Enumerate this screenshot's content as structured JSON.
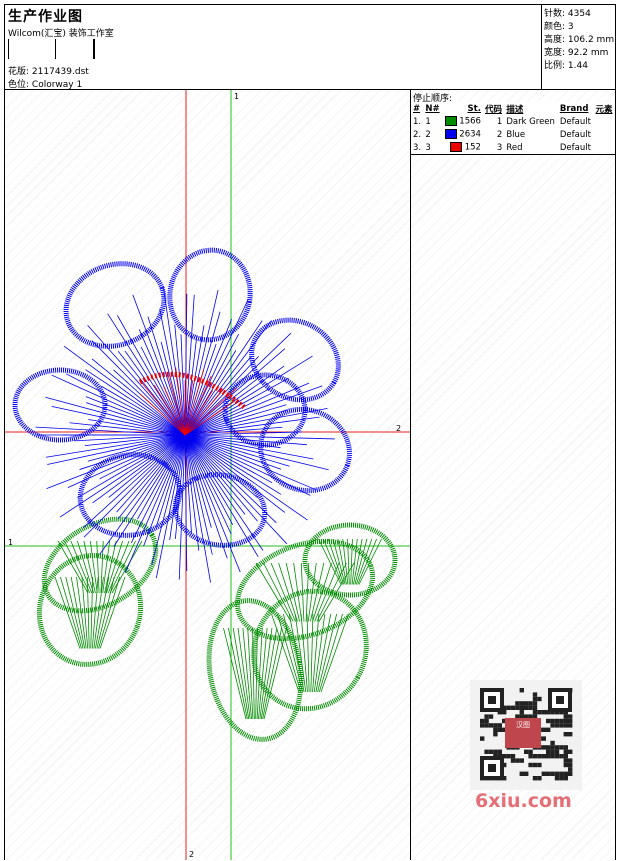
{
  "header": {
    "title": "生产作业图",
    "company": "Wilcom(汇宝) 装饰工作室",
    "design_label": "花版:",
    "design_value": "2117439.dst",
    "colorway_label": "色位:",
    "colorway_value": "Colorway 1"
  },
  "stats": [
    {
      "label": "针数:",
      "value": "4354"
    },
    {
      "label": "颜色:",
      "value": "3"
    },
    {
      "label": "高度:",
      "value": "106.2 mm"
    },
    {
      "label": "宽度:",
      "value": "92.2 mm"
    },
    {
      "label": "比例:",
      "value": "1.44"
    }
  ],
  "stop_sequence": {
    "title": "停止顺序:",
    "columns": [
      "#",
      "N#",
      "St.",
      "代码",
      "描述",
      "Brand",
      "元素"
    ],
    "rows": [
      {
        "index": "1.",
        "n": "1",
        "color": "#008c00",
        "stitches": "1566",
        "code": "1",
        "description": "Dark Green",
        "brand": "Default"
      },
      {
        "index": "2.",
        "n": "2",
        "color": "#0000ee",
        "stitches": "2634",
        "code": "2",
        "description": "Blue",
        "brand": "Default"
      },
      {
        "index": "3.",
        "n": "3",
        "color": "#ee0000",
        "stitches": "152",
        "code": "3",
        "description": "Red",
        "brand": "Default"
      }
    ]
  },
  "axis_labels": {
    "v1": "1",
    "h2": "2",
    "h1": "1",
    "v2": "2"
  },
  "watermark": {
    "text": "6xiu.com",
    "badge": "汉图"
  }
}
